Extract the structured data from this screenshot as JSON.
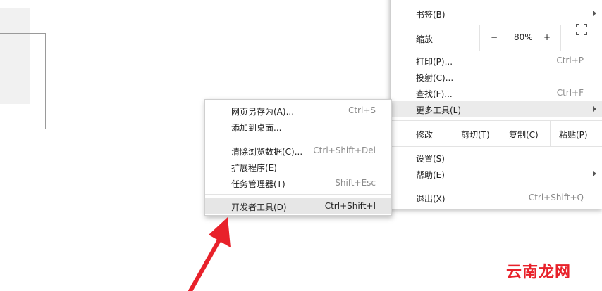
{
  "main_menu": {
    "bookmarks": "书签(B)",
    "zoom_label": "缩放",
    "zoom_minus": "−",
    "zoom_value": "80%",
    "zoom_plus": "+",
    "print": "打印(P)...",
    "print_sc": "Ctrl+P",
    "cast": "投射(C)...",
    "find": "查找(F)...",
    "find_sc": "Ctrl+F",
    "more_tools": "更多工具(L)",
    "edit_label": "修改",
    "cut": "剪切(T)",
    "copy": "复制(C)",
    "paste": "粘贴(P)",
    "settings": "设置(S)",
    "help": "帮助(E)",
    "exit": "退出(X)",
    "exit_sc": "Ctrl+Shift+Q"
  },
  "sub_menu": {
    "save_as": "网页另存为(A)...",
    "save_as_sc": "Ctrl+S",
    "add_desktop": "添加到桌面...",
    "clear_data": "清除浏览数据(C)...",
    "clear_data_sc": "Ctrl+Shift+Del",
    "extensions": "扩展程序(E)",
    "task_manager": "任务管理器(T)",
    "task_manager_sc": "Shift+Esc",
    "devtools": "开发者工具(D)",
    "devtools_sc": "Ctrl+Shift+I"
  },
  "annotation": {
    "arrow_color": "#e8212a"
  },
  "watermark": "云南龙网"
}
